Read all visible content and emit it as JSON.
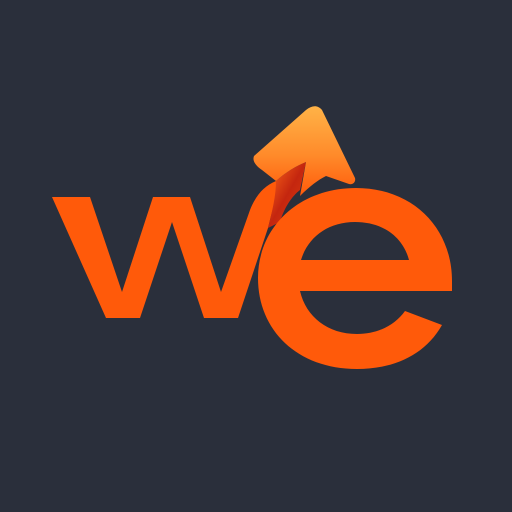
{
  "icon": {
    "name": "app-logo-icon",
    "wordmark": "we",
    "colors": {
      "background": "#2a2f3b",
      "letters": "#ff5a0a",
      "arrow_top": "#ffb347",
      "arrow_bottom": "#ff6a1a",
      "arrow_shadow": "#c4260f"
    }
  }
}
